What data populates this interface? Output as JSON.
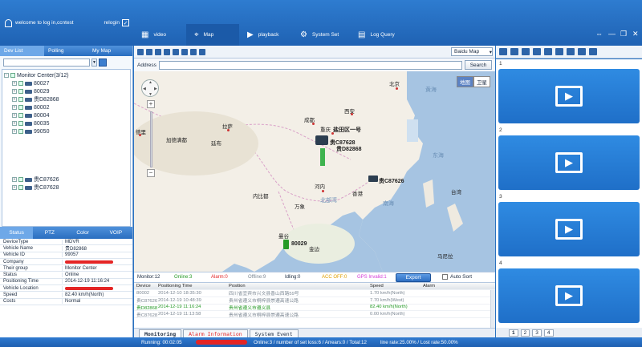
{
  "header": {
    "welcome": "welcome to log in,ccntest",
    "logout_label": "relogin",
    "nav_tabs": [
      {
        "label": "video"
      },
      {
        "label": "Map"
      },
      {
        "label": "playback"
      },
      {
        "label": "System Set"
      },
      {
        "label": "Log Query"
      }
    ]
  },
  "left_tabs": [
    "Dev List",
    "Polling",
    "My Map"
  ],
  "tree": {
    "root": "Monitor Center(3/12)",
    "items": [
      "80027",
      "80029",
      "贵D82868",
      "80002",
      "80004",
      "80035",
      "99050"
    ],
    "items_lower": [
      "贵C87626",
      "贵C87628"
    ]
  },
  "status_tabs": [
    "Status",
    "PTZ",
    "Color",
    "VOIP"
  ],
  "status_rows": [
    {
      "k": "DeviceType",
      "v": "MDVR"
    },
    {
      "k": "Vehicle Name",
      "v": "贵D82868"
    },
    {
      "k": "Vehicle ID",
      "v": "99057"
    },
    {
      "k": "Company",
      "v": ""
    },
    {
      "k": "Their group",
      "v": "Monitor Center"
    },
    {
      "k": "Status",
      "v": "Online"
    },
    {
      "k": "Positioning Time",
      "v": "2014-12-19 11:16:24"
    },
    {
      "k": "Vehicle Location",
      "v": ""
    },
    {
      "k": "Speed",
      "v": "82.40 km/h(North)"
    },
    {
      "k": "Costs",
      "v": "Normal"
    }
  ],
  "map": {
    "type_select": "Baidu Map",
    "address_label": "Address",
    "search_label": "Search",
    "maptype_buttons": [
      "地图",
      "卫星"
    ],
    "labels": {
      "sea_huanghai": "黄海",
      "sea_donghai": "东海",
      "sea_nanhai": "南海",
      "gulf": "北部湾",
      "delhi": "德里",
      "kathmandu": "加德满都",
      "thimphu": "廷布",
      "lhasa": "拉萨",
      "chengdu": "成都",
      "chongqing": "重庆",
      "xian": "西安",
      "beijing": "北京",
      "hanoi": "河内",
      "vientiane": "万象",
      "naypyidaw": "内比都",
      "manila": "马尼拉",
      "hongkong": "香港",
      "taiwan": "台湾",
      "bangkok": "曼谷",
      "phnompenh": "金边",
      "panel_label": "盐田区一号"
    },
    "markers": [
      {
        "label": "贵C87628"
      },
      {
        "label": "贵D82868"
      },
      {
        "label": "贵C87626"
      },
      {
        "label": "80029"
      }
    ]
  },
  "legend": {
    "monitor": "Monitor:12",
    "online": "Online:3",
    "alarm": "Alarm:0",
    "offline": "Offline:9",
    "idling": "Idling:0",
    "acc_off": "ACC OFF:0",
    "gps_invalid": "GPS Invalid:1",
    "export": "Export",
    "autosort": "Auto Sort"
  },
  "table": {
    "headers": [
      "Device",
      "Positioning Time",
      "Position",
      "Speed",
      "Alarm"
    ],
    "rows": [
      {
        "device": "80002",
        "time": "2014-12-10 18:35:30",
        "position": "四川省宜宾市兴文县香山西路59号",
        "speed": "1.70 km/h(North)",
        "alarm": "",
        "color": "gy"
      },
      {
        "device": "贵C87626",
        "time": "2014-12-19 10:48:39",
        "position": "贵州省遵义市桐梓县崇遵高速公路",
        "speed": "7.70 km/h(West)",
        "alarm": "",
        "color": "gy"
      },
      {
        "device": "贵D82868",
        "time": "2014-12-19 11:16:24",
        "position": "贵州省遵义市遵义县",
        "speed": "82.40 km/h(North)",
        "alarm": "",
        "color": "gr"
      },
      {
        "device": "贵C87628",
        "time": "2014-12-19 11:13:58",
        "position": "贵州省遵义市桐梓县崇遵高速公路",
        "speed": "0.00 km/h(North)",
        "alarm": "",
        "color": "gy"
      }
    ]
  },
  "bottom_tabs": [
    "Monitoring",
    "Alarm Information",
    "System Event"
  ],
  "video": {
    "slots": [
      "1",
      "2",
      "3",
      "4"
    ],
    "pages": [
      "1",
      "2",
      "3",
      "4"
    ]
  },
  "statusbar": {
    "running": "Running: 00:02:05",
    "counts": "Online:3 / number of set loss:6 / Arrears:0 / Total:12",
    "line_rate": "line rate:25.00% / Lost rate:50.00%"
  },
  "colors": {
    "accent": "#1f62b3",
    "online": "#269a26",
    "alarm": "#e42525",
    "gps_invalid": "#d43ad8",
    "acc_off": "#e0a000"
  }
}
